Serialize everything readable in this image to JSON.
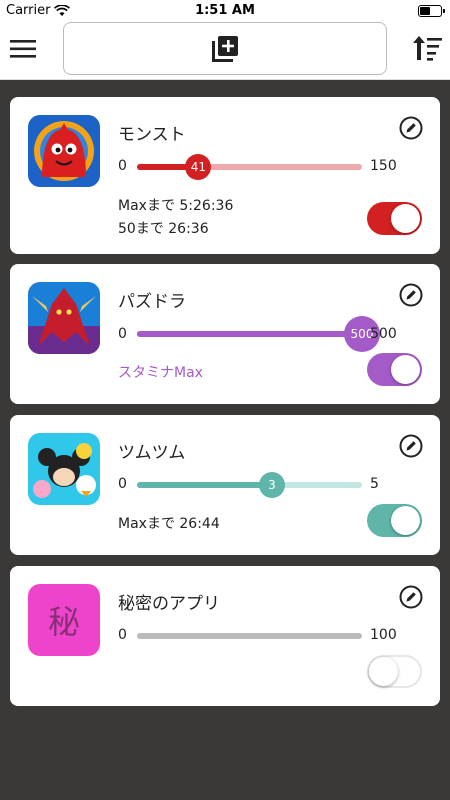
{
  "status_bar": {
    "carrier": "Carrier",
    "time": "1:51 AM"
  },
  "toolbar": {
    "menu_icon": "hamburger-menu-icon",
    "add_icon": "add-stack-icon",
    "sort_icon": "sort-icon"
  },
  "games": [
    {
      "name": "モンスト",
      "icon": "monst-app-icon",
      "min": "0",
      "max": "150",
      "value": 41,
      "value_label": "41",
      "max_value": 150,
      "value_fraction": 0.273,
      "accent": "#d32020",
      "track": "#eeaaaa",
      "lines": [
        "Maxまで 5:26:36",
        "50まで 26:36"
      ],
      "enabled": true
    },
    {
      "name": "パズドラ",
      "icon": "puzzle-dragons-app-icon",
      "min": "0",
      "max": "500",
      "value": 500,
      "value_label": "500",
      "max_value": 500,
      "value_fraction": 1.0,
      "accent": "#a45ac7",
      "track": "#a45ac7",
      "lines": [
        "スタミナMax"
      ],
      "enabled": true
    },
    {
      "name": "ツムツム",
      "icon": "tsum-tsum-app-icon",
      "min": "0",
      "max": "5",
      "value": 3,
      "value_label": "3",
      "max_value": 5,
      "value_fraction": 0.6,
      "accent": "#5fb5aa",
      "track": "#c2e6e1",
      "lines": [
        "Maxまで 26:44"
      ],
      "enabled": true
    },
    {
      "name": "秘密のアプリ",
      "icon": "secret-app-icon",
      "icon_char": "秘",
      "icon_color": "#ee44cc",
      "min": "0",
      "max": "100",
      "value": 0,
      "value_label": "",
      "max_value": 100,
      "value_fraction": 0,
      "accent": "#bbbbbb",
      "track": "#bbbbbb",
      "lines": [],
      "enabled": false
    }
  ],
  "colors": {
    "background": "#3b3938",
    "card": "#ffffff",
    "bar": "#ffffff"
  }
}
